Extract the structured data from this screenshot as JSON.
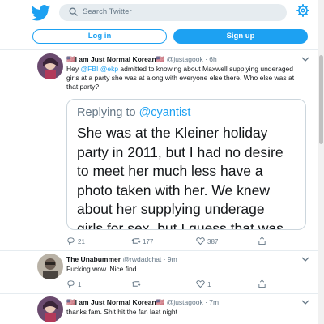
{
  "header": {
    "search_placeholder": "Search Twitter",
    "login_label": "Log in",
    "signup_label": "Sign up"
  },
  "tweets": [
    {
      "name": "🇺🇸I am Just Normal Korean🇺🇸",
      "handle": "@justagook",
      "time": "· 6h",
      "text_pre": "Hey ",
      "mention1": "@FBI",
      "mention2": "@ekp",
      "text_post": " admitted to knowing about Maxwell supplying underaged girls at a party she was at along with everyone else there. Who else was at that party?",
      "quote": {
        "replying_prefix": "Replying to ",
        "replying_to": "@cyantist",
        "lines": [
          "She was at the Kleiner holiday",
          "party in 2011, but I had no desire",
          "to meet her much less have a",
          "photo taken with her. We knew",
          "about her supplying underage",
          "girls for sex, but I guess that was"
        ]
      },
      "replies": "21",
      "retweets": "177",
      "likes": "387"
    },
    {
      "name": "The Unabummer",
      "handle": "@rwdadchat",
      "time": "· 9m",
      "text": "Fucking wow. Nice find",
      "replies": "1",
      "retweets": "",
      "likes": "1"
    },
    {
      "name": "🇺🇸I am Just Normal Korean🇺🇸",
      "handle": "@justagook",
      "time": "· 7m",
      "text": "thanks fam. Shit hit the fan last night"
    }
  ],
  "colors": {
    "accent": "#1da1f2",
    "text": "#14171a",
    "muted": "#657786",
    "border": "#e6ecf0"
  },
  "icons": [
    "twitter-bird-icon",
    "search-icon",
    "gear-icon",
    "reply-icon",
    "retweet-icon",
    "like-icon",
    "share-icon",
    "caret-down-icon"
  ]
}
